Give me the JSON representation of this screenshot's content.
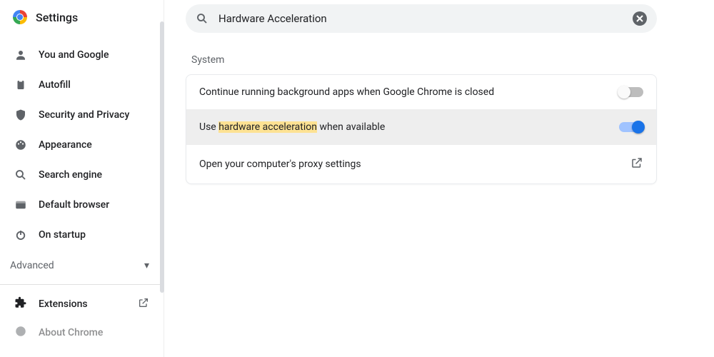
{
  "header": {
    "title": "Settings"
  },
  "sidebar": {
    "items": [
      {
        "label": "You and Google",
        "icon": "person"
      },
      {
        "label": "Autofill",
        "icon": "clipboard"
      },
      {
        "label": "Security and Privacy",
        "icon": "shield"
      },
      {
        "label": "Appearance",
        "icon": "palette"
      },
      {
        "label": "Search engine",
        "icon": "search"
      },
      {
        "label": "Default browser",
        "icon": "browser"
      },
      {
        "label": "On startup",
        "icon": "power"
      }
    ],
    "advanced_label": "Advanced",
    "extensions_label": "Extensions",
    "about_label": "About Chrome"
  },
  "search": {
    "value": "Hardware Acceleration"
  },
  "section": {
    "title": "System",
    "rows": [
      {
        "label": "Continue running background apps when Google Chrome is closed",
        "toggle": "off"
      },
      {
        "label_pre": "Use ",
        "label_hl": "hardware acceleration",
        "label_post": " when available",
        "toggle": "on",
        "highlighted": true
      },
      {
        "label": "Open your computer's proxy settings",
        "action": "open"
      }
    ]
  }
}
